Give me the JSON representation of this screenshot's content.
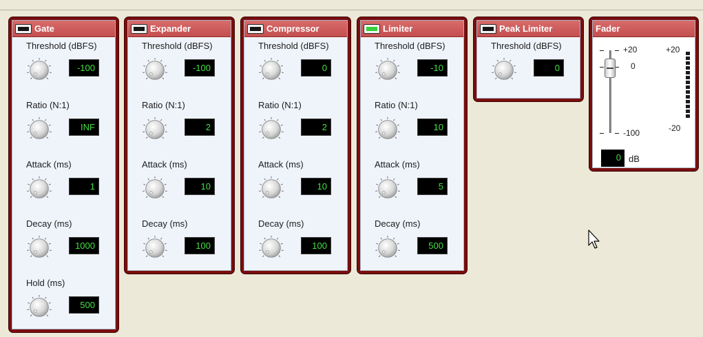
{
  "panels": [
    {
      "title": "Gate",
      "enabled": false,
      "params": [
        {
          "label": "Threshold (dBFS)",
          "value": "-100"
        },
        {
          "label": "Ratio (N:1)",
          "value": "INF"
        },
        {
          "label": "Attack (ms)",
          "value": "1"
        },
        {
          "label": "Decay (ms)",
          "value": "1000"
        },
        {
          "label": "Hold (ms)",
          "value": "500"
        }
      ]
    },
    {
      "title": "Expander",
      "enabled": false,
      "params": [
        {
          "label": "Threshold (dBFS)",
          "value": "-100"
        },
        {
          "label": "Ratio (N:1)",
          "value": "2"
        },
        {
          "label": "Attack (ms)",
          "value": "10"
        },
        {
          "label": "Decay (ms)",
          "value": "100"
        }
      ]
    },
    {
      "title": "Compressor",
      "enabled": false,
      "params": [
        {
          "label": "Threshold (dBFS)",
          "value": "0"
        },
        {
          "label": "Ratio (N:1)",
          "value": "2"
        },
        {
          "label": "Attack (ms)",
          "value": "10"
        },
        {
          "label": "Decay (ms)",
          "value": "100"
        }
      ]
    },
    {
      "title": "Limiter",
      "enabled": true,
      "params": [
        {
          "label": "Threshold (dBFS)",
          "value": "-10"
        },
        {
          "label": "Ratio (N:1)",
          "value": "10"
        },
        {
          "label": "Attack (ms)",
          "value": "5"
        },
        {
          "label": "Decay (ms)",
          "value": "500"
        }
      ]
    },
    {
      "title": "Peak Limiter",
      "enabled": false,
      "params": [
        {
          "label": "Threshold (dBFS)",
          "value": "0"
        }
      ]
    }
  ],
  "fader": {
    "title": "Fader",
    "scale_top": "+20",
    "scale_zero": "0",
    "scale_bottom": "-100",
    "meter_top": "+20",
    "meter_bottom": "-20",
    "value": "0",
    "unit": "dB"
  },
  "colors": {
    "accent_red": "#c44f4f",
    "led_on": "#35d03a",
    "readout_green": "#43e043"
  }
}
